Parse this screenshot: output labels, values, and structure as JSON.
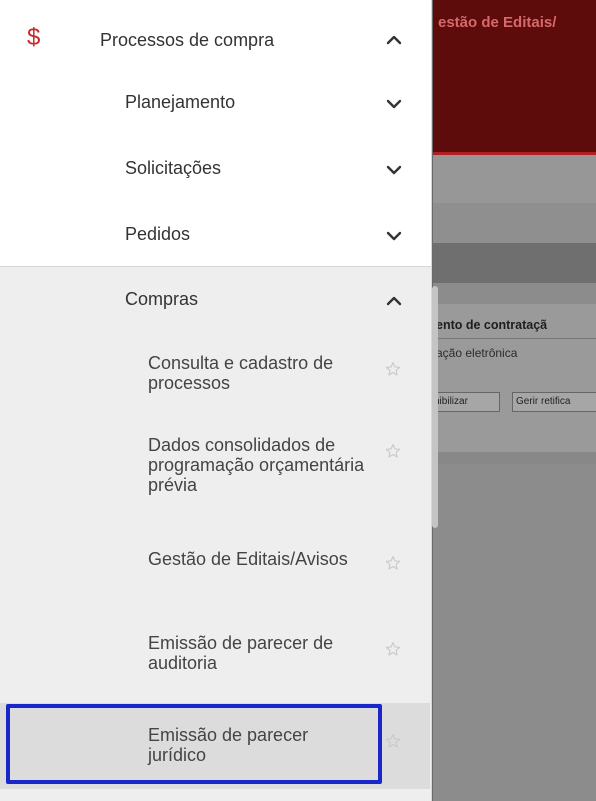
{
  "background": {
    "header_title": "estão de Editais/",
    "panel_title": "ento de contrataçã",
    "panel_text": "ação eletrônica",
    "buttons": [
      "nibilizar",
      "Gerir retifica"
    ]
  },
  "menu": {
    "section": {
      "icon": "dollar-icon",
      "label": "Processos de compra",
      "expanded": true
    },
    "groups": [
      {
        "label": "Planejamento",
        "expanded": false
      },
      {
        "label": "Solicitações",
        "expanded": false
      },
      {
        "label": "Pedidos",
        "expanded": false
      },
      {
        "label": "Compras",
        "expanded": true
      }
    ],
    "compras_items": [
      {
        "label": "Consulta e cadastro de processos"
      },
      {
        "label": "Dados consolidados de programação orçamentária prévia"
      },
      {
        "label": "Gestão de Editais/Avisos"
      },
      {
        "label": "Emissão de parecer de auditoria"
      },
      {
        "label": "Emissão de parecer jurídico",
        "selected": true
      }
    ]
  },
  "colors": {
    "accent": "#c62828",
    "focus": "#1a27c8",
    "header_bg": "#5e0b0b"
  }
}
